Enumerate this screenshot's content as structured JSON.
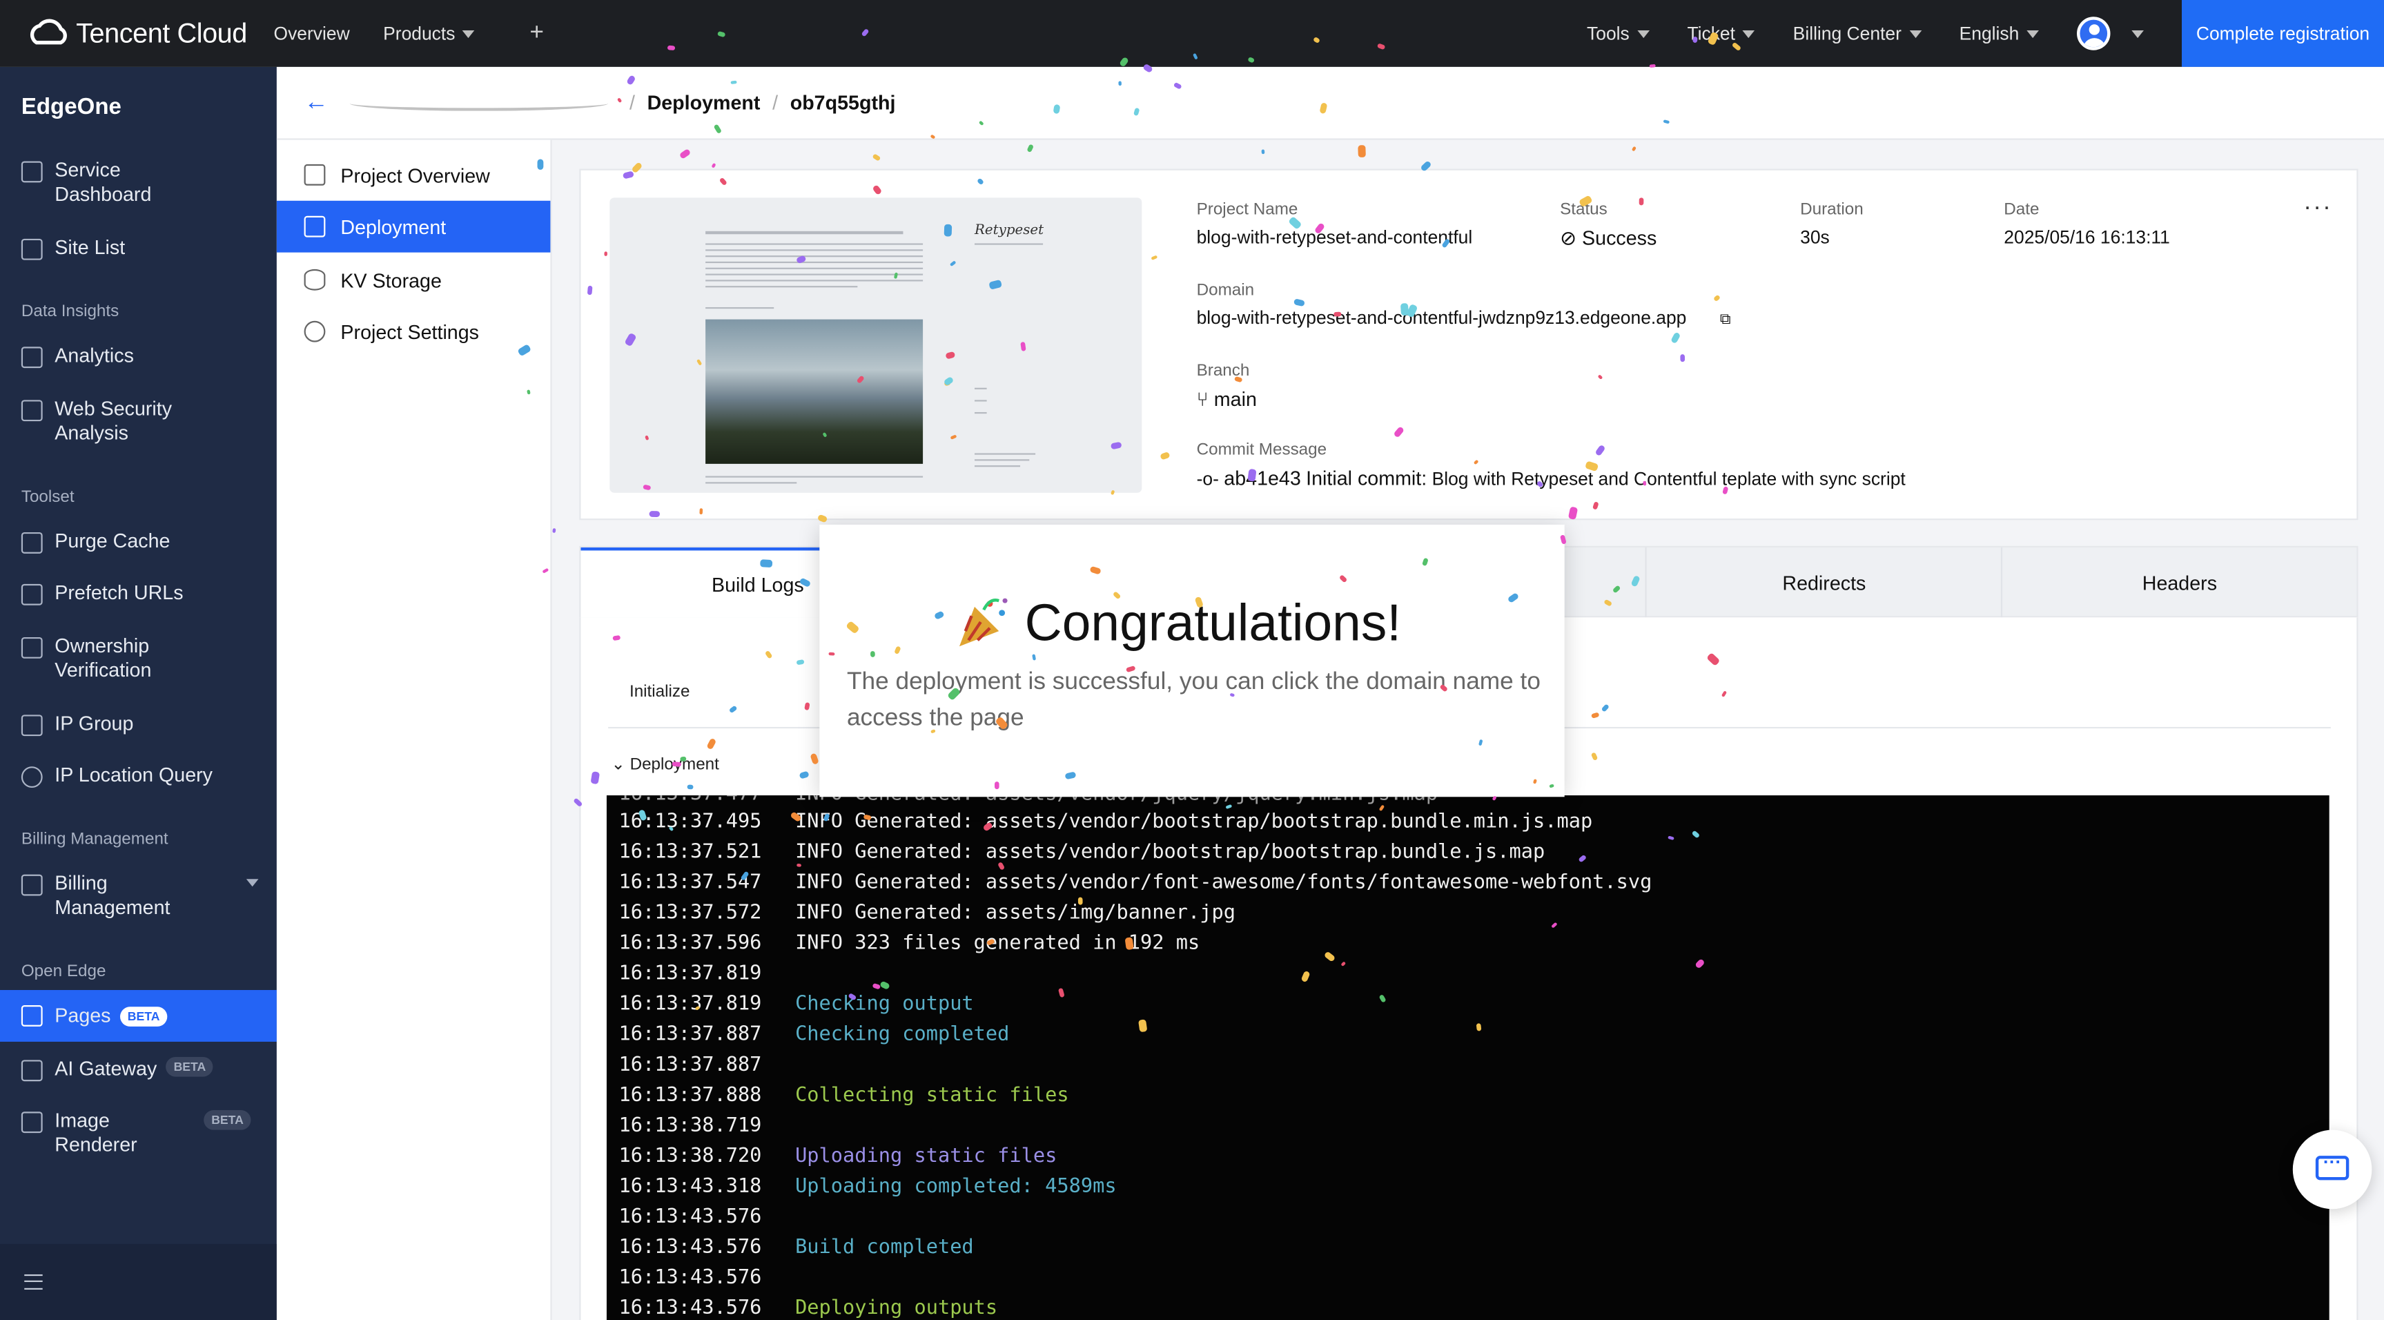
{
  "topbar": {
    "brand": "Tencent Cloud",
    "nav": [
      "Overview",
      "Products"
    ],
    "right": [
      "Tools",
      "Ticket",
      "Billing Center",
      "English"
    ],
    "register": "Complete registration"
  },
  "sidebar": {
    "brand": "EdgeOne",
    "items": [
      {
        "label": "Service\nDashboard"
      },
      {
        "label": "Site List"
      },
      {
        "section": "Data Insights"
      },
      {
        "label": "Analytics"
      },
      {
        "label": "Web Security\nAnalysis"
      },
      {
        "section": "Toolset"
      },
      {
        "label": "Purge Cache"
      },
      {
        "label": "Prefetch URLs"
      },
      {
        "label": "Ownership\nVerification"
      },
      {
        "label": "IP Group"
      },
      {
        "label": "IP Location Query"
      },
      {
        "section": "Billing Management"
      },
      {
        "label": "Billing\nManagement"
      },
      {
        "section": "Open Edge"
      },
      {
        "label": "Pages",
        "badge": "BETA"
      },
      {
        "label": "AI Gateway",
        "badge": "BETA"
      },
      {
        "label": "Image\nRenderer",
        "badge": "BETA"
      }
    ]
  },
  "breadcrumb": {
    "section": "Deployment",
    "id": "ob7q55gthj"
  },
  "subnav": [
    "Project Overview",
    "Deployment",
    "KV Storage",
    "Project Settings"
  ],
  "deployment": {
    "project_name_label": "Project Name",
    "project_name": "blog-with-retypeset-and-contentful",
    "status_label": "Status",
    "status": "Success",
    "duration_label": "Duration",
    "duration": "30s",
    "date_label": "Date",
    "date": "2025/05/16 16:13:11",
    "domain_label": "Domain",
    "domain": "blog-with-retypeset-and-contentful-jwdznp9z13.edgeone.app",
    "branch_label": "Branch",
    "branch": "main",
    "commit_label": "Commit Message",
    "commit_hash": "ab41e43",
    "commit_title": "Initial commit:",
    "commit_message": "Blog with Retypeset and Contentful teplate with sync script",
    "thumb_brand": "Retypeset"
  },
  "tabs": [
    "Build Logs",
    "Redirects",
    "Headers"
  ],
  "logs": {
    "step_initialize": "Initialize",
    "step_deployment": "Deployment",
    "lines": [
      {
        "ts": "16:13:37.495",
        "text": "INFO Generated: assets/vendor/bootstrap/bootstrap.bundle.min.js.map",
        "c": ""
      },
      {
        "ts": "16:13:37.521",
        "text": "INFO Generated: assets/vendor/bootstrap/bootstrap.bundle.js.map",
        "c": ""
      },
      {
        "ts": "16:13:37.547",
        "text": "INFO Generated: assets/vendor/font-awesome/fonts/fontawesome-webfont.svg",
        "c": ""
      },
      {
        "ts": "16:13:37.572",
        "text": "INFO Generated: assets/img/banner.jpg",
        "c": ""
      },
      {
        "ts": "16:13:37.596",
        "text": "INFO 323 files generated in 192 ms",
        "c": ""
      },
      {
        "ts": "16:13:37.819",
        "text": "",
        "c": ""
      },
      {
        "ts": "16:13:37.819",
        "text": "Checking output",
        "c": "cyan"
      },
      {
        "ts": "16:13:37.887",
        "text": "Checking completed",
        "c": "cyan"
      },
      {
        "ts": "16:13:37.887",
        "text": "",
        "c": ""
      },
      {
        "ts": "16:13:37.888",
        "text": "Collecting static files",
        "c": "green"
      },
      {
        "ts": "16:13:38.719",
        "text": "",
        "c": ""
      },
      {
        "ts": "16:13:38.720",
        "text": "Uploading static files",
        "c": "purple"
      },
      {
        "ts": "16:13:43.318",
        "text": "Uploading completed: 4589ms",
        "c": "cyan"
      },
      {
        "ts": "16:13:43.576",
        "text": "",
        "c": ""
      },
      {
        "ts": "16:13:43.576",
        "text": "Build completed",
        "c": "cyan"
      },
      {
        "ts": "16:13:43.576",
        "text": "",
        "c": ""
      },
      {
        "ts": "16:13:43.576",
        "text": "Deploying outputs",
        "c": "green"
      }
    ]
  },
  "modal": {
    "title": "Congratulations!",
    "body": "The deployment is successful, you can click the domain name to access the page"
  },
  "colors": {
    "accent": "#2464f5",
    "sidebar": "#1f2b45",
    "success": "#2aa64a"
  }
}
